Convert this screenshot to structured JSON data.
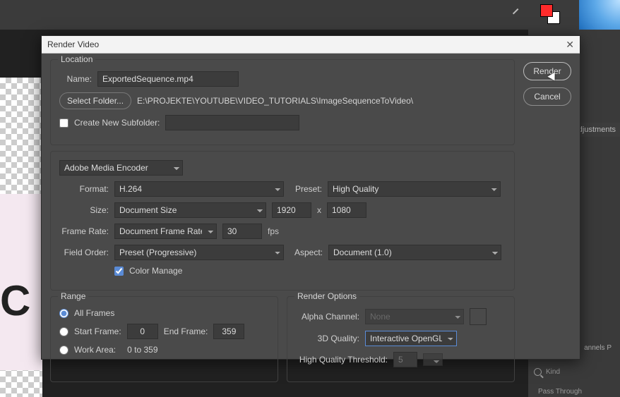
{
  "dialog": {
    "title": "Render Video",
    "buttons": {
      "render": "Render",
      "cancel": "Cancel"
    }
  },
  "location": {
    "legend": "Location",
    "nameLabel": "Name:",
    "nameValue": "ExportedSequence.mp4",
    "selectFolder": "Select Folder...",
    "path": "E:\\PROJEKTE\\YOUTUBE\\VIDEO_TUTORIALS\\ImageSequenceToVideo\\",
    "createSubfolderLabel": "Create New Subfolder:",
    "subfolderValue": ""
  },
  "encoder": {
    "engine": "Adobe Media Encoder",
    "formatLabel": "Format:",
    "format": "H.264",
    "presetLabel": "Preset:",
    "preset": "High Quality",
    "sizeLabel": "Size:",
    "sizeMode": "Document Size",
    "width": "1920",
    "xSymbol": "x",
    "height": "1080",
    "frameRateLabel": "Frame Rate:",
    "frameRateMode": "Document Frame Rate",
    "frameRate": "30",
    "fpsLabel": "fps",
    "fieldOrderLabel": "Field Order:",
    "fieldOrder": "Preset (Progressive)",
    "aspectLabel": "Aspect:",
    "aspect": "Document (1.0)",
    "colorManageLabel": "Color Manage"
  },
  "range": {
    "legend": "Range",
    "allFrames": "All Frames",
    "startFrameLabel": "Start Frame:",
    "startFrame": "0",
    "endFrameLabel": "End Frame:",
    "endFrame": "359",
    "workAreaLabel": "Work Area:",
    "workAreaRange": "0 to 359"
  },
  "renderOptions": {
    "legend": "Render Options",
    "alphaLabel": "Alpha Channel:",
    "alpha": "None",
    "qualityLabel": "3D Quality:",
    "quality": "Interactive OpenGL",
    "thresholdLabel": "High Quality Threshold:",
    "threshold": "5"
  },
  "background": {
    "adjustments": "Adjustments",
    "channels": "annels     P",
    "kindLabel": "Kind",
    "passThrough": "Pass Through",
    "bigLetter": "C"
  }
}
